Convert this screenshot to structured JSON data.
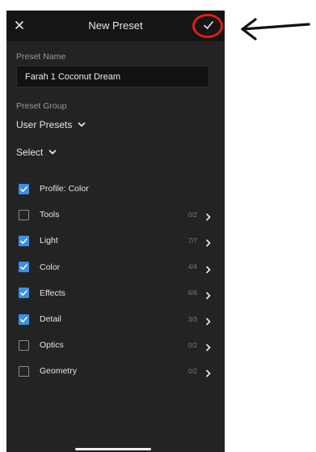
{
  "header": {
    "title": "New Preset",
    "close_icon": "close-icon",
    "confirm_icon": "checkmark-icon"
  },
  "preset_name": {
    "label": "Preset Name",
    "value": "Farah 1 Coconut Dream"
  },
  "preset_group": {
    "label": "Preset Group",
    "value": "User Presets"
  },
  "select": {
    "label": "Select"
  },
  "settings": [
    {
      "label": "Profile: Color",
      "checked": true,
      "count": "",
      "has_chevron": false
    },
    {
      "label": "Tools",
      "checked": false,
      "count": "0/2",
      "has_chevron": true
    },
    {
      "label": "Light",
      "checked": true,
      "count": "7/7",
      "has_chevron": true
    },
    {
      "label": "Color",
      "checked": true,
      "count": "4/4",
      "has_chevron": true
    },
    {
      "label": "Effects",
      "checked": true,
      "count": "6/6",
      "has_chevron": true
    },
    {
      "label": "Detail",
      "checked": true,
      "count": "3/3",
      "has_chevron": true
    },
    {
      "label": "Optics",
      "checked": false,
      "count": "0/2",
      "has_chevron": true
    },
    {
      "label": "Geometry",
      "checked": false,
      "count": "0/2",
      "has_chevron": true
    }
  ],
  "colors": {
    "accent": "#3a8fe8",
    "background": "#232323",
    "annotation": "#e01b1b"
  }
}
